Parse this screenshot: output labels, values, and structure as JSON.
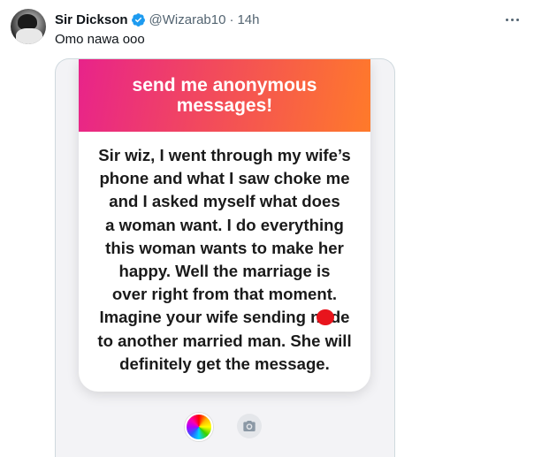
{
  "tweet": {
    "display_name": "Sir Dickson",
    "handle": "@Wizarab10",
    "separator": "·",
    "time": "14h",
    "text": "Omo nawa ooo",
    "verified_color": "#1d9bf0",
    "avatar_icon": "profile-photo",
    "more_icon": "more-horizontal-icon"
  },
  "media": {
    "header_line1": "send me anonymous",
    "header_line2": "messages!",
    "header_gradient": [
      "#e8238a",
      "#f24a5c",
      "#ff7a2a"
    ],
    "message_lines": [
      "Sir wiz, I went through my wife’s",
      "phone and what I saw choke me",
      "and I asked myself what does",
      "a woman want. I do everything",
      "this woman wants to make her",
      "happy. Well the marriage is",
      "over right from that moment.",
      "Imagine your wife sending nude",
      "to another married man. She will",
      "definitely get the message."
    ],
    "redaction_color": "#e8141c",
    "icons": [
      "color-wheel-icon",
      "camera-icon"
    ]
  }
}
